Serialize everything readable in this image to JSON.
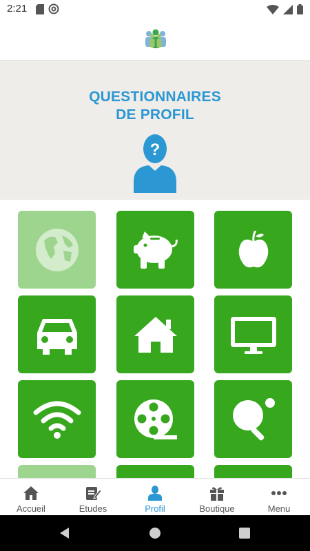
{
  "status_bar": {
    "time": "2:21",
    "left_icons": [
      "sd-card-icon",
      "at-sign-icon"
    ],
    "right_icons": [
      "wifi-icon",
      "signal-icon",
      "battery-icon"
    ]
  },
  "header": {
    "logo_icon": "people-group-logo"
  },
  "hero": {
    "title_line1": "QUESTIONNAIRES",
    "title_line2": "DE PROFIL",
    "avatar_icon": "question-person-icon"
  },
  "colors": {
    "accent_blue": "#2b97d3",
    "tile_green": "#37a71e",
    "tile_faded": "#9ed58e",
    "hero_bg": "#efedea"
  },
  "tiles": [
    {
      "icon": "globe-icon",
      "state": "faded"
    },
    {
      "icon": "piggy-bank-icon",
      "state": "active"
    },
    {
      "icon": "apple-icon",
      "state": "active"
    },
    {
      "icon": "car-icon",
      "state": "active"
    },
    {
      "icon": "house-icon",
      "state": "active"
    },
    {
      "icon": "monitor-icon",
      "state": "active"
    },
    {
      "icon": "wifi-icon",
      "state": "active"
    },
    {
      "icon": "film-reel-icon",
      "state": "active"
    },
    {
      "icon": "ping-pong-icon",
      "state": "active"
    },
    {
      "icon": "unknown-icon",
      "state": "faded"
    },
    {
      "icon": "unknown-icon",
      "state": "active"
    },
    {
      "icon": "unknown-icon",
      "state": "active"
    }
  ],
  "bottom_nav": {
    "items": [
      {
        "label": "Accueil",
        "icon": "home-icon",
        "active": false
      },
      {
        "label": "Etudes",
        "icon": "edit-document-icon",
        "active": false
      },
      {
        "label": "Profil",
        "icon": "person-icon",
        "active": true
      },
      {
        "label": "Boutique",
        "icon": "gift-icon",
        "active": false
      },
      {
        "label": "Menu",
        "icon": "more-dots-icon",
        "active": false
      }
    ]
  },
  "system_nav": {
    "buttons": [
      "back-button",
      "home-button",
      "recents-button"
    ]
  }
}
